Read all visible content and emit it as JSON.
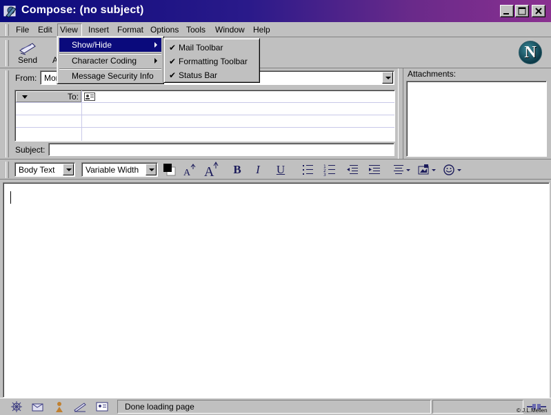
{
  "window": {
    "title": "Compose: (no subject)"
  },
  "menubar": {
    "items": [
      {
        "label": "File"
      },
      {
        "label": "Edit"
      },
      {
        "label": "View"
      },
      {
        "label": "Insert"
      },
      {
        "label": "Format"
      },
      {
        "label": "Options"
      },
      {
        "label": "Tools"
      },
      {
        "label": "Window"
      },
      {
        "label": "Help"
      }
    ]
  },
  "view_menu": {
    "items": [
      {
        "label": "Show/Hide"
      },
      {
        "label": "Character Coding"
      },
      {
        "label": "Message Security Info"
      }
    ]
  },
  "showhide_submenu": {
    "items": [
      {
        "label": "Mail Toolbar",
        "checked": true
      },
      {
        "label": "Formatting Toolbar",
        "checked": true
      },
      {
        "label": "Status Bar",
        "checked": true
      }
    ]
  },
  "toolbar": {
    "send_label": "Send",
    "partial_label": "A",
    "logo_letter": "N"
  },
  "header": {
    "from_label": "From:",
    "from_value": "Mor",
    "to_label": "To:",
    "subject_label": "Subject:",
    "subject_value": "",
    "attachments_label": "Attachments:"
  },
  "format_toolbar": {
    "paragraph_style": "Body Text",
    "font": "Variable Width",
    "bold": "B",
    "italic": "I",
    "underline": "U"
  },
  "status": {
    "text": "Done loading page"
  },
  "watermark": "© J.L.Mellen",
  "colors": {
    "titlebar_start": "#0a0a7c",
    "titlebar_end": "#8a3090",
    "selection": "#0a0a7c"
  }
}
